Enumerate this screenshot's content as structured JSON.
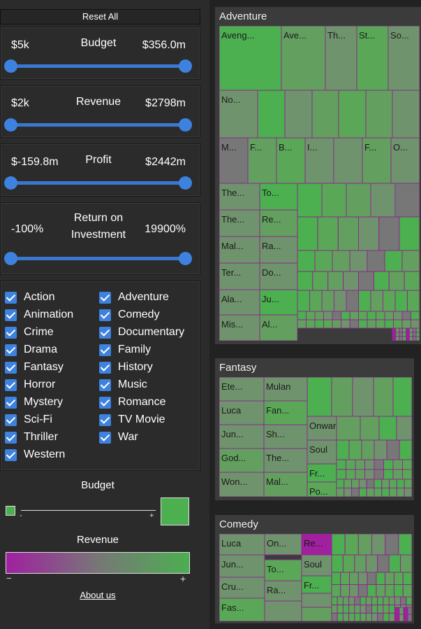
{
  "reset_label": "Reset All",
  "sliders": [
    {
      "id": "budget",
      "title": "Budget",
      "min": "$5k",
      "max": "$356.0m"
    },
    {
      "id": "revenue",
      "title": "Revenue",
      "min": "$2k",
      "max": "$2798m"
    },
    {
      "id": "profit",
      "title": "Profit",
      "min": "$-159.8m",
      "max": "$2442m"
    },
    {
      "id": "roi",
      "title_line1": "Return on",
      "title_line2": "Investment",
      "min": "-100%",
      "max": "19900%"
    }
  ],
  "genres_left": [
    "Action",
    "Animation",
    "Crime",
    "Drama",
    "Fantasy",
    "Horror",
    "Mystery",
    "Sci-Fi",
    "Thriller",
    "Western"
  ],
  "genres_right": [
    "Adventure",
    "Comedy",
    "Documentary",
    "Family",
    "History",
    "Music",
    "Romance",
    "TV Movie",
    "War"
  ],
  "legend": {
    "budget_title": "Budget",
    "budget_minus": "-",
    "budget_plus": "+",
    "revenue_title": "Revenue",
    "revenue_minus": "−",
    "revenue_plus": "+",
    "colors": {
      "low": "#a020a0",
      "mid": "#777777",
      "high": "#4caf50"
    }
  },
  "about_label": "About us",
  "panels": [
    {
      "title": "Adventure",
      "labels": [
        "Aveng...",
        "Ave...",
        "Th...",
        "St...",
        "So...",
        "No...",
        "M...",
        "F...",
        "B...",
        "I...",
        "F...",
        "O...",
        "The...",
        "To...",
        "The...",
        "Re...",
        "Mal...",
        "Ra...",
        "Ter...",
        "Do...",
        "Ala...",
        "Ju...",
        "Mis...",
        "Al..."
      ]
    },
    {
      "title": "Fantasy",
      "labels": [
        "Ete...",
        "Mulan",
        "Luca",
        "Fan...",
        "Jun...",
        "Sh...",
        "Onward",
        "Soul",
        "God...",
        "The...",
        "Fr...",
        "Won...",
        "Mal...",
        "Po..."
      ]
    },
    {
      "title": "Comedy",
      "labels": [
        "Luca",
        "On...",
        "Re...",
        "Jun...",
        "Soul",
        "To...",
        "Cru...",
        "Fr...",
        "Ra...",
        "Fas..."
      ]
    }
  ]
}
